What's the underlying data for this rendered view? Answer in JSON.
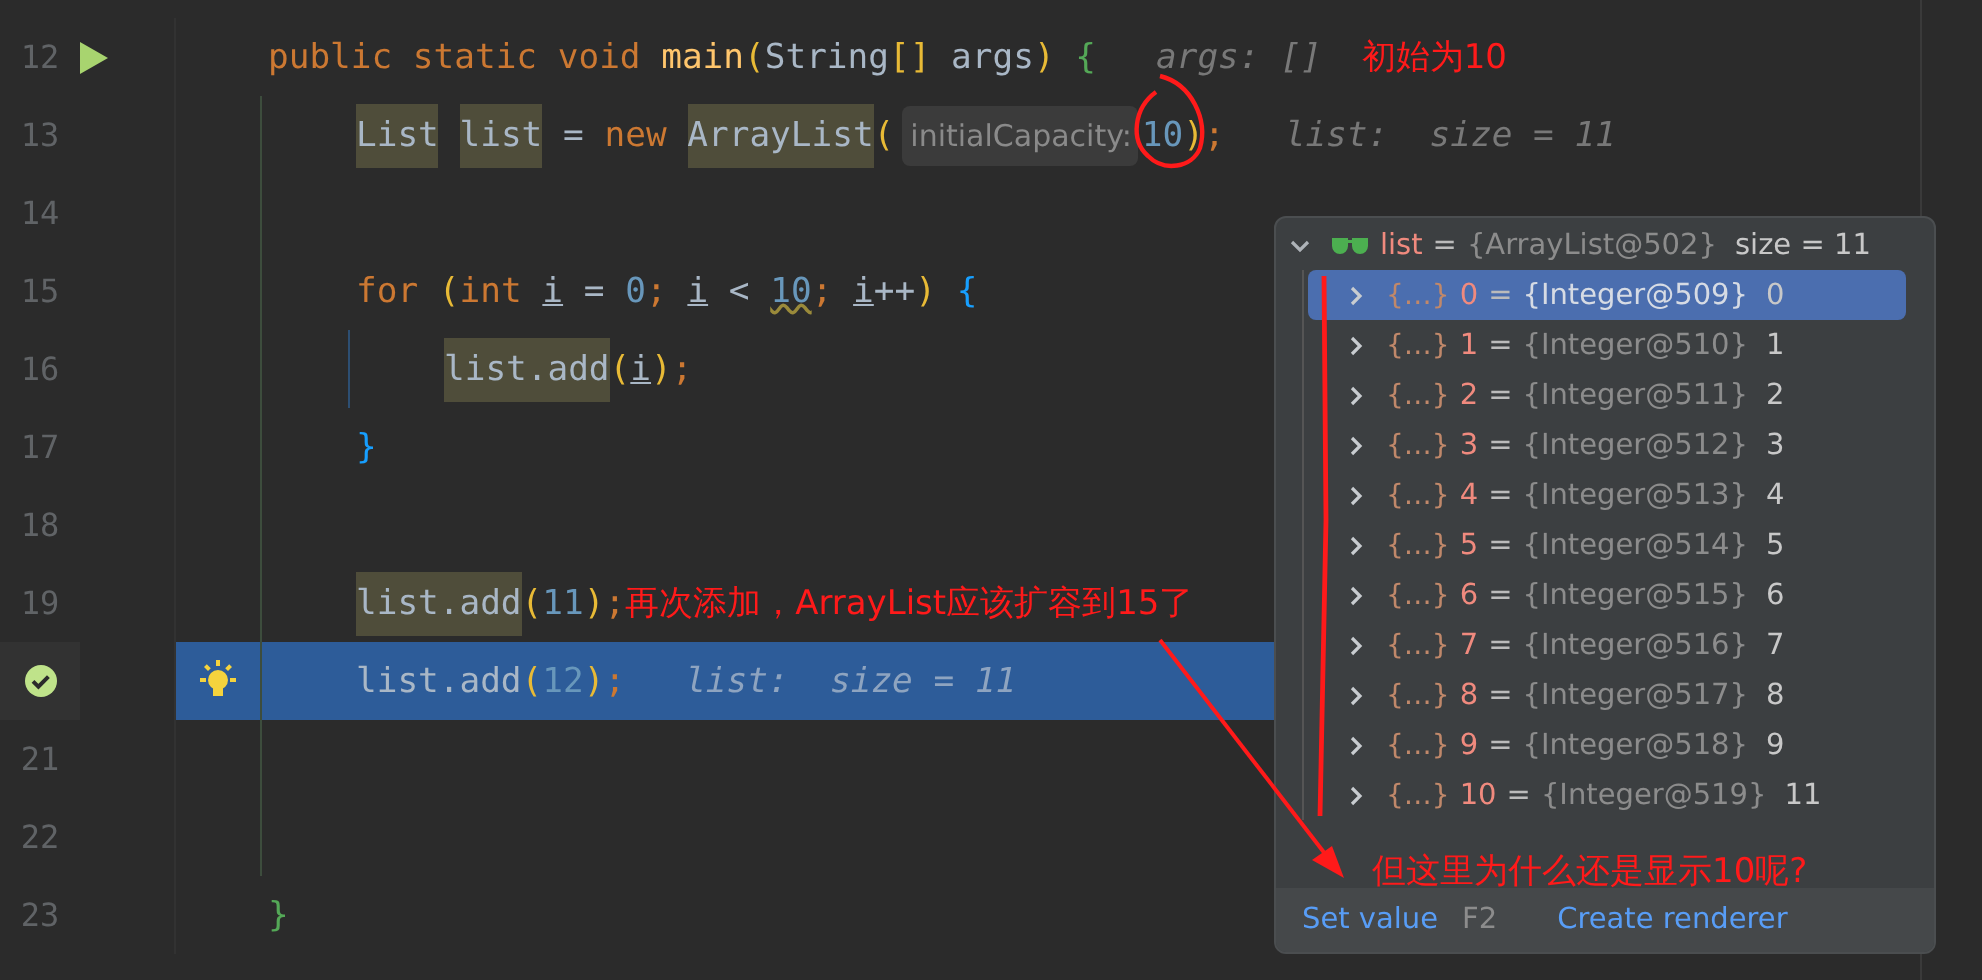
{
  "editor": {
    "lines": [
      {
        "number": "12",
        "kind": "runnable",
        "selected": false,
        "tokens": [
          {
            "text": "public static void ",
            "kind": "keyword"
          },
          {
            "text": "main",
            "kind": "method"
          },
          {
            "text": "(",
            "kind": "paren"
          },
          {
            "text": "String",
            "kind": "plain"
          },
          {
            "text": "[]",
            "kind": "paren"
          },
          {
            "text": " args",
            "kind": "plain"
          },
          {
            "text": ")",
            "kind": "paren"
          },
          {
            "text": " {",
            "kind": "brace-green"
          },
          {
            "text": "args: []",
            "kind": "value-hint"
          },
          {
            "text": "初始为10",
            "kind": "annotation"
          }
        ],
        "children": [
          {
            "number": "13",
            "selected": false,
            "tokens": [
              {
                "text": "List",
                "kind": "marked"
              },
              {
                "text": " list",
                "kind": "marked"
              },
              {
                "text": " =",
                "kind": "plain"
              },
              {
                "text": " new",
                "kind": "keyword"
              },
              {
                "text": " ArrayList",
                "kind": "marked"
              },
              {
                "text": "(",
                "kind": "paren"
              },
              {
                "text": "initialCapacity:",
                "kind": "param-hint"
              },
              {
                "text": "10",
                "kind": "number"
              },
              {
                "text": ")",
                "kind": "paren"
              },
              {
                "text": ";",
                "kind": "keyword"
              },
              {
                "text": "list:  size = 11",
                "kind": "value-hint"
              }
            ]
          },
          {
            "number": "14",
            "selected": false
          },
          {
            "number": "15",
            "selected": false,
            "tokens": [
              {
                "text": "for",
                "kind": "keyword"
              },
              {
                "text": " (",
                "kind": "paren"
              },
              {
                "text": "int",
                "kind": "keyword"
              },
              {
                "text": " i",
                "kind": "underlined"
              },
              {
                "text": " =",
                "kind": "plain"
              },
              {
                "text": " 0",
                "kind": "number"
              },
              {
                "text": ";",
                "kind": "keyword"
              },
              {
                "text": " i",
                "kind": "underlined"
              },
              {
                "text": " <",
                "kind": "plain"
              },
              {
                "text": " 10",
                "kind": "number-warn"
              },
              {
                "text": ";",
                "kind": "keyword"
              },
              {
                "text": " i",
                "kind": "underlined"
              },
              {
                "text": "++",
                "kind": "plain"
              },
              {
                "text": ")",
                "kind": "paren"
              },
              {
                "text": " {",
                "kind": "brace-blue"
              }
            ],
            "children": [
              {
                "number": "16",
                "selected": false,
                "tokens": [
                  {
                    "text": "list.add",
                    "kind": "marked"
                  },
                  {
                    "text": "(",
                    "kind": "paren"
                  },
                  {
                    "text": "i",
                    "kind": "underlined"
                  },
                  {
                    "text": ")",
                    "kind": "paren"
                  },
                  {
                    "text": ";",
                    "kind": "keyword"
                  }
                ]
              }
            ]
          },
          {
            "number": "17",
            "selected": false,
            "tokens": [
              {
                "text": "}",
                "kind": "brace-blue"
              }
            ]
          },
          {
            "number": "18",
            "selected": false
          },
          {
            "number": "19",
            "selected": false,
            "tokens": [
              {
                "text": "list.add",
                "kind": "marked"
              },
              {
                "text": "(",
                "kind": "paren"
              },
              {
                "text": "11",
                "kind": "number"
              },
              {
                "text": ")",
                "kind": "paren"
              },
              {
                "text": ";",
                "kind": "keyword"
              },
              {
                "text": "再次添加，ArrayList应该扩容到15了",
                "kind": "annotation"
              }
            ]
          },
          {
            "kind": "execution-point",
            "selected": true,
            "tokens": [
              {
                "text": "list.add",
                "kind": "plain"
              },
              {
                "text": "(",
                "kind": "paren"
              },
              {
                "text": "12",
                "kind": "number"
              },
              {
                "text": ")",
                "kind": "paren"
              },
              {
                "text": ";",
                "kind": "keyword"
              },
              {
                "text": "list:  size = 11",
                "kind": "value-hint"
              }
            ]
          },
          {
            "number": "21",
            "selected": false
          },
          {
            "number": "22",
            "selected": false
          }
        ]
      },
      {
        "number": "23",
        "selected": false,
        "tokens": [
          {
            "text": "}",
            "kind": "brace-green"
          }
        ]
      }
    ]
  },
  "debugger_popup": {
    "root": {
      "name": "list",
      "sep": "=",
      "value": "{ArrayList@502}",
      "extra": "size = 11",
      "expanded": true,
      "children": [
        {
          "glyph": "{…}",
          "name": "0",
          "sep": "=",
          "value": "{Integer@509}",
          "extra": "0",
          "selected": true
        },
        {
          "glyph": "{…}",
          "name": "1",
          "sep": "=",
          "value": "{Integer@510}",
          "extra": "1",
          "selected": false
        },
        {
          "glyph": "{…}",
          "name": "2",
          "sep": "=",
          "value": "{Integer@511}",
          "extra": "2",
          "selected": false
        },
        {
          "glyph": "{…}",
          "name": "3",
          "sep": "=",
          "value": "{Integer@512}",
          "extra": "3",
          "selected": false
        },
        {
          "glyph": "{…}",
          "name": "4",
          "sep": "=",
          "value": "{Integer@513}",
          "extra": "4",
          "selected": false
        },
        {
          "glyph": "{…}",
          "name": "5",
          "sep": "=",
          "value": "{Integer@514}",
          "extra": "5",
          "selected": false
        },
        {
          "glyph": "{…}",
          "name": "6",
          "sep": "=",
          "value": "{Integer@515}",
          "extra": "6",
          "selected": false
        },
        {
          "glyph": "{…}",
          "name": "7",
          "sep": "=",
          "value": "{Integer@516}",
          "extra": "7",
          "selected": false
        },
        {
          "glyph": "{…}",
          "name": "8",
          "sep": "=",
          "value": "{Integer@517}",
          "extra": "8",
          "selected": false
        },
        {
          "glyph": "{…}",
          "name": "9",
          "sep": "=",
          "value": "{Integer@518}",
          "extra": "9",
          "selected": false
        },
        {
          "glyph": "{…}",
          "name": "10",
          "sep": "=",
          "value": "{Integer@519}",
          "extra": "11",
          "selected": false
        }
      ]
    },
    "note": "但这里为什么还是显示10呢?",
    "actions": [
      {
        "label": "Set value",
        "shortcut": "F2"
      },
      {
        "label": "Create renderer"
      }
    ]
  }
}
